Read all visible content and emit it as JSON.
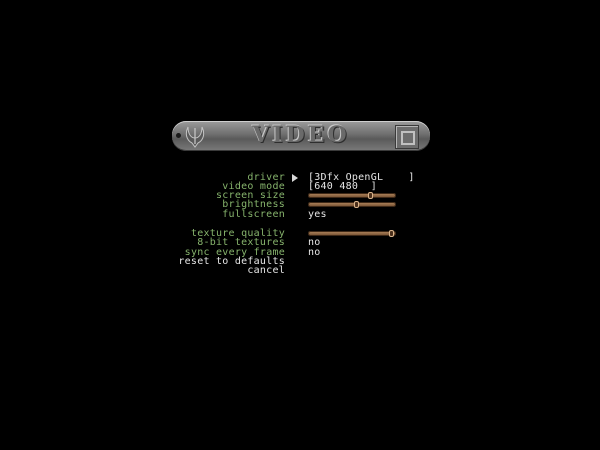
{
  "banner": {
    "title": "VIDEO"
  },
  "menu": {
    "driver": {
      "label": "driver",
      "value": "[3Dfx OpenGL    ]"
    },
    "video_mode": {
      "label": "video mode",
      "value": "[640 480  ]"
    },
    "screen_size": {
      "label": "screen size",
      "level": 0.72
    },
    "brightness": {
      "label": "brightness",
      "level": 0.55
    },
    "fullscreen": {
      "label": "fullscreen",
      "value": "yes"
    },
    "texture_quality": {
      "label": "texture quality",
      "level": 0.98
    },
    "eight_bit_textures": {
      "label": "8-bit textures",
      "value": "no"
    },
    "sync_every_frame": {
      "label": "sync every frame",
      "value": "no"
    },
    "reset_to_defaults": {
      "label": "reset to defaults"
    },
    "cancel": {
      "label": "cancel"
    }
  },
  "colors": {
    "background": "#000000",
    "label_green": "#86b36c",
    "label_white": "#e6e6e6",
    "value_text": "#e6e6e6",
    "slider_bar": "#b58a60"
  },
  "icons": {
    "cursor": "menu-cursor-icon",
    "banner_left": "quake-logo-icon",
    "banner_right": "id-logo-icon"
  }
}
